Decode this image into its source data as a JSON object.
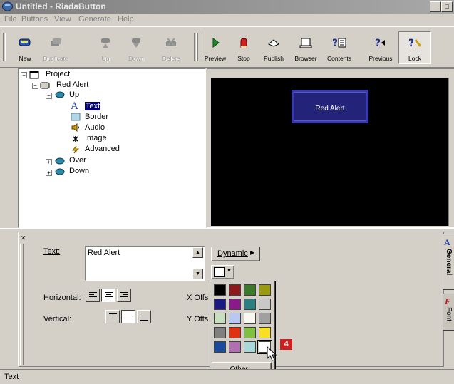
{
  "window": {
    "title": "Untitled - RiadaButton",
    "controls": [
      "_",
      "□"
    ]
  },
  "menu": [
    {
      "label": "File",
      "key": "F"
    },
    {
      "label": "Buttons",
      "key": "B"
    },
    {
      "label": "View",
      "key": "V"
    },
    {
      "label": "Generate",
      "key": "G"
    },
    {
      "label": "Help",
      "key": "H"
    }
  ],
  "toolbar": {
    "left": [
      {
        "label": "New",
        "icon": "new-icon",
        "enabled": true
      },
      {
        "label": "Duplicate",
        "icon": "duplicate-icon",
        "enabled": false
      },
      {
        "label": "Up",
        "icon": "up-icon",
        "enabled": false
      },
      {
        "label": "Down",
        "icon": "down-icon",
        "enabled": false
      },
      {
        "label": "Delete",
        "icon": "delete-icon",
        "enabled": false
      }
    ],
    "right": [
      {
        "label": "Preview",
        "icon": "play-icon"
      },
      {
        "label": "Stop",
        "icon": "stop-hand-icon"
      },
      {
        "label": "Publish",
        "icon": "publish-icon"
      },
      {
        "label": "Browser",
        "icon": "browser-icon"
      },
      {
        "label": "Contents",
        "icon": "contents-icon"
      },
      {
        "label": "Previous",
        "icon": "previous-icon"
      },
      {
        "label": "Lock",
        "icon": "lock-icon"
      }
    ]
  },
  "tree": {
    "project": "Project",
    "button": "Red Alert",
    "state_up": "Up",
    "children": [
      "Text",
      "Border",
      "Audio",
      "Image",
      "Advanced"
    ],
    "state_over": "Over",
    "state_down": "Down"
  },
  "preview": {
    "button_text": "Red Alert",
    "background": "#000000",
    "button_color": "#23237a"
  },
  "properties": {
    "text_label": "Text:",
    "text_value": "Red Alert",
    "dynamic_label": "Dynamic",
    "horizontal_label": "Horizontal:",
    "vertical_label": "Vertical:",
    "x_offset_label": "X Offs",
    "y_offset_label": "Y Offs",
    "selected_color": "#ffffff",
    "other_label": "Other...",
    "palette": [
      [
        "#000000",
        "#8b1a1a",
        "#3a7a2a",
        "#9a9a10"
      ],
      [
        "#1a1a80",
        "#8a1a8a",
        "#2a8080",
        "#c8c8c8"
      ],
      [
        "#c8e0c0",
        "#b8c8f0",
        "#f8f8f0",
        "#a0a0a0"
      ],
      [
        "#808080",
        "#e03010",
        "#80c040",
        "#f8e020"
      ],
      [
        "#1a4a9a",
        "#b070b0",
        "#a8d8d8",
        "#ffffff"
      ]
    ]
  },
  "side_tabs": [
    "General",
    "Font"
  ],
  "badge": "4",
  "status": "Text"
}
